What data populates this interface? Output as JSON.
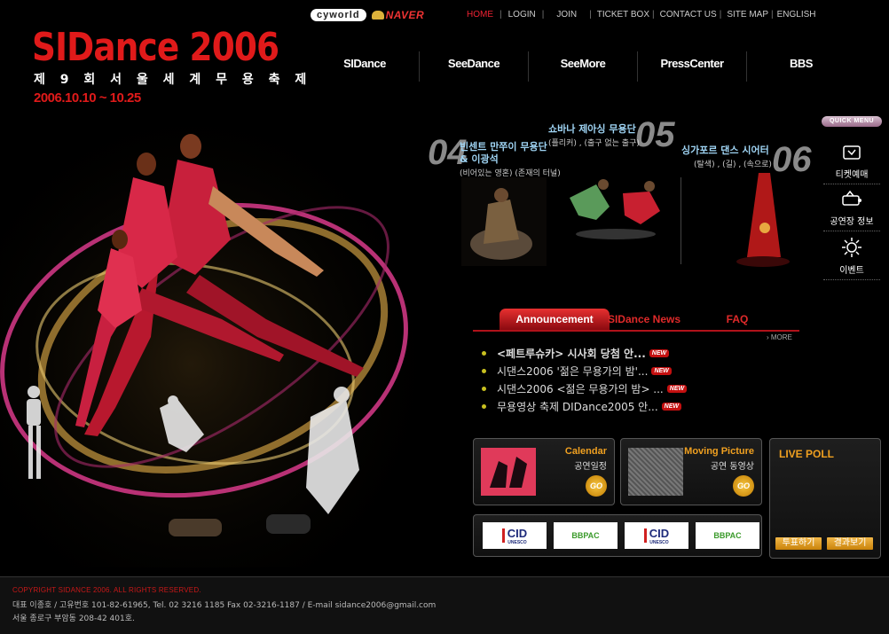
{
  "partners": {
    "cyworld": "cyworld",
    "naver": "NAVER"
  },
  "util_nav": [
    "HOME",
    "LOGIN",
    "JOIN",
    "TICKET BOX",
    "CONTACT US",
    "SITE MAP",
    "ENGLISH"
  ],
  "logo": {
    "title": "SIDance 2006",
    "subtitle": "제 9 회 서 울 세 계 무 용 축 제",
    "dates": "2006.10.10 ~ 10.25"
  },
  "main_nav": [
    "SIDance",
    "SeeDance",
    "SeeMore",
    "PressCenter",
    "BBS"
  ],
  "programs": [
    {
      "num": "04",
      "title1": "빈센트 만쭈이 무용단",
      "title2": "& 이광석",
      "sub": "(비어있는 영혼) (존재의 터널)"
    },
    {
      "num": "05",
      "title1": "쇼바나 제아싱 무용단",
      "title2": "",
      "sub": "(플리커) , (출구 없는 출구)"
    },
    {
      "num": "06",
      "title1": "싱가포르 댄스 시어터",
      "title2": "",
      "sub": "(탈색) , (길) , (속으로)"
    }
  ],
  "quick_menu": {
    "label": "QUICK MENU",
    "items": [
      "티켓예매",
      "공연장 정보",
      "이벤트"
    ]
  },
  "tabs": [
    "Announcement",
    "SIDance News",
    "FAQ"
  ],
  "more_label": "MORE",
  "news": [
    {
      "title": "<페트루슈카> 시사회 당첨 안...",
      "badge": "NEW"
    },
    {
      "title": "시댄스2006 '젊은 무용가의 밤'...",
      "badge": "NEW"
    },
    {
      "title": "시댄스2006 <젊은 무용가의 밤> ...",
      "badge": "NEW"
    },
    {
      "title": "무용영상 축제 DIDance2005 안...",
      "badge": "NEW"
    }
  ],
  "calendar": {
    "title": "Calendar",
    "subtitle": "공연일정",
    "go": "GO"
  },
  "moving_picture": {
    "title": "Moving Picture",
    "subtitle": "공연 동영상",
    "go": "GO"
  },
  "live_poll": {
    "title": "LIVE POLL",
    "vote": "투표하기",
    "results": "결과보기"
  },
  "sponsors": {
    "cid": "CID",
    "cid_sub": "UNESCO",
    "bbc": "BBPAC"
  },
  "footer": {
    "copyright": "COPYRIGHT SIDANCE 2006. ALL RIGHTS RESERVED.",
    "info": "대표 이종호 / 고유번호 101-82-61965, Tel. 02 3216 1185  Fax 02-3216-1187 / E-mail  sidance2006@gmail.com",
    "address": "서울 종로구 부암동 208-42 401호."
  }
}
